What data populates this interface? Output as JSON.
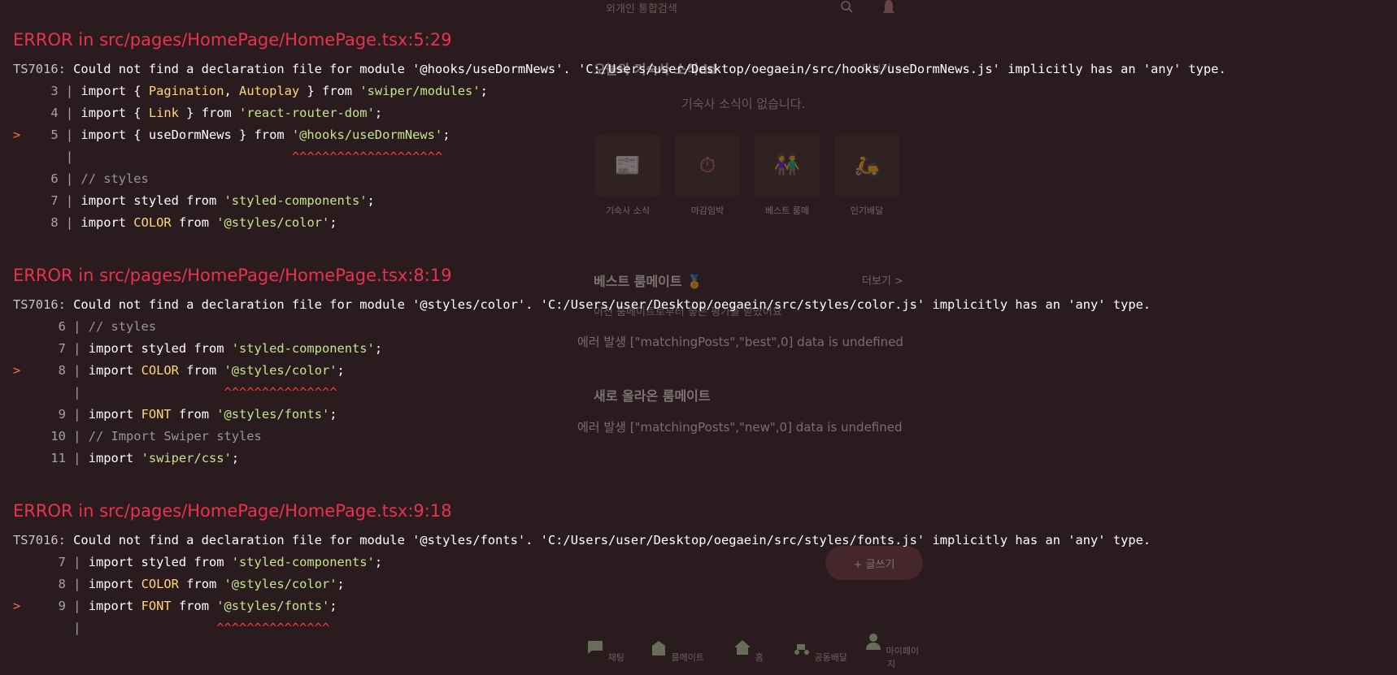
{
  "background_app": {
    "search_placeholder": "외개인 통합검색",
    "news_title": "오늘의 기숙사 소식dd",
    "news_more": "더보기 >",
    "news_empty": "기숙사 소식이 없습니다.",
    "categories": [
      "기숙사 소식",
      "마감임박",
      "베스트 룸메",
      "인기배달"
    ],
    "best_title": "베스트 룸메이트 🏅",
    "best_more": "더보기 >",
    "best_subtitle": "이전 룸메이트로부터 좋은 평가를 받았어요",
    "best_error": "에러 발생 [\"matchingPosts\",\"best\",0] data is undefined",
    "new_title": "새로 올라온 룸메이트",
    "new_error": "에러 발생 [\"matchingPosts\",\"new\",0] data is undefined",
    "fab_label": "+ 글쓰기",
    "nav": [
      "채팅",
      "룸메이트",
      "홈",
      "공동배달",
      "마이페이지"
    ]
  },
  "errors": [
    {
      "title": "ERROR in src/pages/HomePage/HomePage.tsx:5:29",
      "code": "TS7016:",
      "message": " Could not find a declaration file for module '@hooks/useDormNews'. 'C:/Users/user/Desktop/oegaein/src/hooks/useDormNews.js' implicitly has an 'any' type.",
      "lines": [
        {
          "marker": "  ",
          "gutter": "   3 | ",
          "tokens": [
            [
              "kw",
              "import { "
            ],
            [
              "ident",
              "Pagination"
            ],
            [
              "kw",
              ", "
            ],
            [
              "ident",
              "Autoplay"
            ],
            [
              "kw",
              " } from "
            ],
            [
              "str",
              "'swiper/modules'"
            ],
            [
              "kw",
              ";"
            ]
          ]
        },
        {
          "marker": "  ",
          "gutter": "   4 | ",
          "tokens": [
            [
              "kw",
              "import { "
            ],
            [
              "ident",
              "Link"
            ],
            [
              "kw",
              " } from "
            ],
            [
              "str",
              "'react-router-dom'"
            ],
            [
              "kw",
              ";"
            ]
          ]
        },
        {
          "marker": "> ",
          "gutter": "   5 | ",
          "tokens": [
            [
              "kw",
              "import { useDormNews } from "
            ],
            [
              "str",
              "'@hooks/useDormNews'"
            ],
            [
              "kw",
              ";"
            ]
          ]
        },
        {
          "marker": "  ",
          "gutter": "     | ",
          "tokens": [
            [
              "kw",
              "                            "
            ],
            [
              "carets",
              "^^^^^^^^^^^^^^^^^^^^"
            ]
          ]
        },
        {
          "marker": "  ",
          "gutter": "   6 | ",
          "tokens": [
            [
              "cmt",
              "// styles"
            ]
          ]
        },
        {
          "marker": "  ",
          "gutter": "   7 | ",
          "tokens": [
            [
              "kw",
              "import styled from "
            ],
            [
              "str",
              "'styled-components'"
            ],
            [
              "kw",
              ";"
            ]
          ]
        },
        {
          "marker": "  ",
          "gutter": "   8 | ",
          "tokens": [
            [
              "kw",
              "import "
            ],
            [
              "ident",
              "COLOR"
            ],
            [
              "kw",
              " from "
            ],
            [
              "str",
              "'@styles/color'"
            ],
            [
              "kw",
              ";"
            ]
          ]
        }
      ]
    },
    {
      "title": "ERROR in src/pages/HomePage/HomePage.tsx:8:19",
      "code": "TS7016:",
      "message": " Could not find a declaration file for module '@styles/color'. 'C:/Users/user/Desktop/oegaein/src/styles/color.js' implicitly has an 'any' type.",
      "lines": [
        {
          "marker": "  ",
          "gutter": "    6 | ",
          "tokens": [
            [
              "cmt",
              "// styles"
            ]
          ]
        },
        {
          "marker": "  ",
          "gutter": "    7 | ",
          "tokens": [
            [
              "kw",
              "import styled from "
            ],
            [
              "str",
              "'styled-components'"
            ],
            [
              "kw",
              ";"
            ]
          ]
        },
        {
          "marker": "> ",
          "gutter": "    8 | ",
          "tokens": [
            [
              "kw",
              "import "
            ],
            [
              "ident",
              "COLOR"
            ],
            [
              "kw",
              " from "
            ],
            [
              "str",
              "'@styles/color'"
            ],
            [
              "kw",
              ";"
            ]
          ]
        },
        {
          "marker": "  ",
          "gutter": "      | ",
          "tokens": [
            [
              "kw",
              "                  "
            ],
            [
              "carets",
              "^^^^^^^^^^^^^^^"
            ]
          ]
        },
        {
          "marker": "  ",
          "gutter": "    9 | ",
          "tokens": [
            [
              "kw",
              "import "
            ],
            [
              "ident",
              "FONT"
            ],
            [
              "kw",
              " from "
            ],
            [
              "str",
              "'@styles/fonts'"
            ],
            [
              "kw",
              ";"
            ]
          ]
        },
        {
          "marker": "  ",
          "gutter": "   10 | ",
          "tokens": [
            [
              "cmt",
              "// Import Swiper styles"
            ]
          ]
        },
        {
          "marker": "  ",
          "gutter": "   11 | ",
          "tokens": [
            [
              "kw",
              "import "
            ],
            [
              "str",
              "'swiper/css'"
            ],
            [
              "kw",
              ";"
            ]
          ]
        }
      ]
    },
    {
      "title": "ERROR in src/pages/HomePage/HomePage.tsx:9:18",
      "code": "TS7016:",
      "message": " Could not find a declaration file for module '@styles/fonts'. 'C:/Users/user/Desktop/oegaein/src/styles/fonts.js' implicitly has an 'any' type.",
      "lines": [
        {
          "marker": "  ",
          "gutter": "    7 | ",
          "tokens": [
            [
              "kw",
              "import styled from "
            ],
            [
              "str",
              "'styled-components'"
            ],
            [
              "kw",
              ";"
            ]
          ]
        },
        {
          "marker": "  ",
          "gutter": "    8 | ",
          "tokens": [
            [
              "kw",
              "import "
            ],
            [
              "ident",
              "COLOR"
            ],
            [
              "kw",
              " from "
            ],
            [
              "str",
              "'@styles/color'"
            ],
            [
              "kw",
              ";"
            ]
          ]
        },
        {
          "marker": "> ",
          "gutter": "    9 | ",
          "tokens": [
            [
              "kw",
              "import "
            ],
            [
              "ident",
              "FONT"
            ],
            [
              "kw",
              " from "
            ],
            [
              "str",
              "'@styles/fonts'"
            ],
            [
              "kw",
              ";"
            ]
          ]
        },
        {
          "marker": "  ",
          "gutter": "      | ",
          "tokens": [
            [
              "kw",
              "                 "
            ],
            [
              "carets",
              "^^^^^^^^^^^^^^^"
            ]
          ]
        }
      ]
    }
  ],
  "colors": {
    "error_title": "#e8324f",
    "marker": "#ff6b4a",
    "identifier": "#ffd67a",
    "string": "#c6e48b",
    "comment": "#9a9596",
    "carets": "#ff3b3b",
    "background": "#2a1c1e"
  }
}
